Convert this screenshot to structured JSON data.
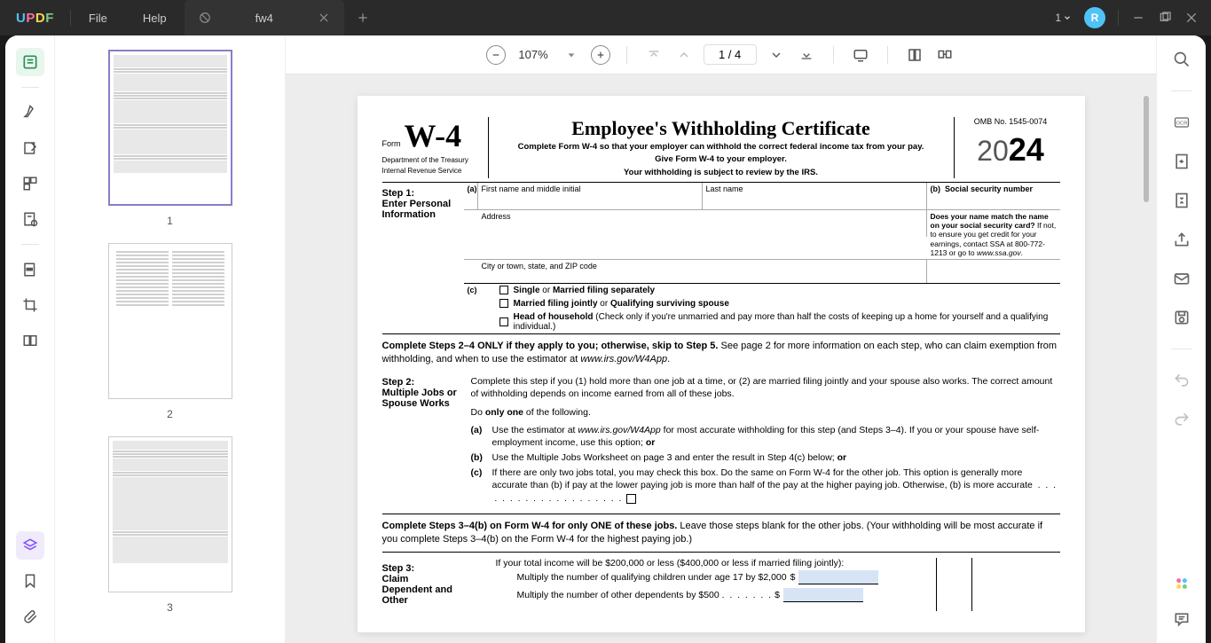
{
  "app": {
    "logo": "UPDF",
    "menus": [
      "File",
      "Help"
    ],
    "tab_name": "fw4",
    "notification_count": "1",
    "avatar_letter": "R"
  },
  "toolbar": {
    "zoom": "107%",
    "page_display": "1 / 4"
  },
  "thumbnails": {
    "pages": [
      "1",
      "2",
      "3"
    ]
  },
  "form": {
    "name_label": "Form",
    "name": "W-4",
    "dept1": "Department of the Treasury",
    "dept2": "Internal Revenue Service",
    "title": "Employee's Withholding Certificate",
    "sub1": "Complete Form W-4 so that your employer can withhold the correct federal income tax from your pay.",
    "sub2": "Give Form W-4 to your employer.",
    "sub3": "Your withholding is subject to review by the IRS.",
    "omb": "OMB No. 1545-0074",
    "year_prefix": "20",
    "year": "24",
    "step1": {
      "label_b": "Step 1:",
      "label": "Enter Personal Information",
      "a": "(a)",
      "first_name": "First name and middle initial",
      "last_name": "Last name",
      "b": "(b)",
      "ssn": "Social security number",
      "address": "Address",
      "city": "City or town, state, and ZIP code",
      "name_match_b": "Does your name match the name on your social security card?",
      "name_match": " If not, to ensure you get credit for your earnings, contact SSA at 800-772-1213 or go to ",
      "name_match_url": "www.ssa.gov",
      "c": "(c)",
      "filing1_b": "Single",
      "filing1_or": " or ",
      "filing1_b2": "Married filing separately",
      "filing2_b": "Married filing jointly",
      "filing2_or": " or ",
      "filing2_b2": "Qualifying surviving spouse",
      "filing3_b": "Head of household",
      "filing3": " (Check only if you're unmarried and pay more than half the costs of keeping up a home for yourself and a qualifying individual.)"
    },
    "instr1_b": "Complete Steps 2–4 ONLY if they apply to you; otherwise, skip to Step 5.",
    "instr1": " See page 2 for more information on each step, who can claim exemption from withholding, and when to use the estimator at ",
    "instr1_url": "www.irs.gov/W4App",
    "step2": {
      "label_b": "Step 2:",
      "label": "Multiple Jobs or Spouse Works",
      "intro": "Complete this step if you (1) hold more than one job at a time, or (2) are married filing jointly and your spouse also works. The correct amount of withholding depends on income earned from all of these jobs.",
      "do": "Do ",
      "only_one": "only one",
      "do_rest": " of the following.",
      "a_marker": "(a)",
      "a": "Use the estimator at ",
      "a_url": "www.irs.gov/W4App",
      "a_rest": " for most accurate withholding for this step (and Steps 3–4). If you or your spouse have self-employment income, use this option; ",
      "a_or": "or",
      "b_marker": "(b)",
      "b": "Use the Multiple Jobs Worksheet on page 3 and enter the result in Step 4(c) below; ",
      "b_or": "or",
      "c_marker": "(c)",
      "c": "If there are only two jobs total, you may check this box. Do the same on Form W-4 for the other job. This option is generally more accurate than (b) if pay at the lower paying job is more than half of the pay at the higher paying job. Otherwise, (b) is more accurate"
    },
    "instr2_b": "Complete Steps 3–4(b) on Form W-4 for only ONE of these jobs.",
    "instr2": " Leave those steps blank for the other jobs. (Your withholding will be most accurate if you complete Steps 3–4(b) on the Form W-4 for the highest paying job.)",
    "step3": {
      "label_b": "Step 3:",
      "label": "Claim Dependent and Other",
      "intro": "If your total income will be $200,000 or less ($400,000 or less if married filing jointly):",
      "line1": "Multiply the number of qualifying children under age 17 by $2,000",
      "line2": "Multiply the number of other dependents by $500"
    }
  }
}
